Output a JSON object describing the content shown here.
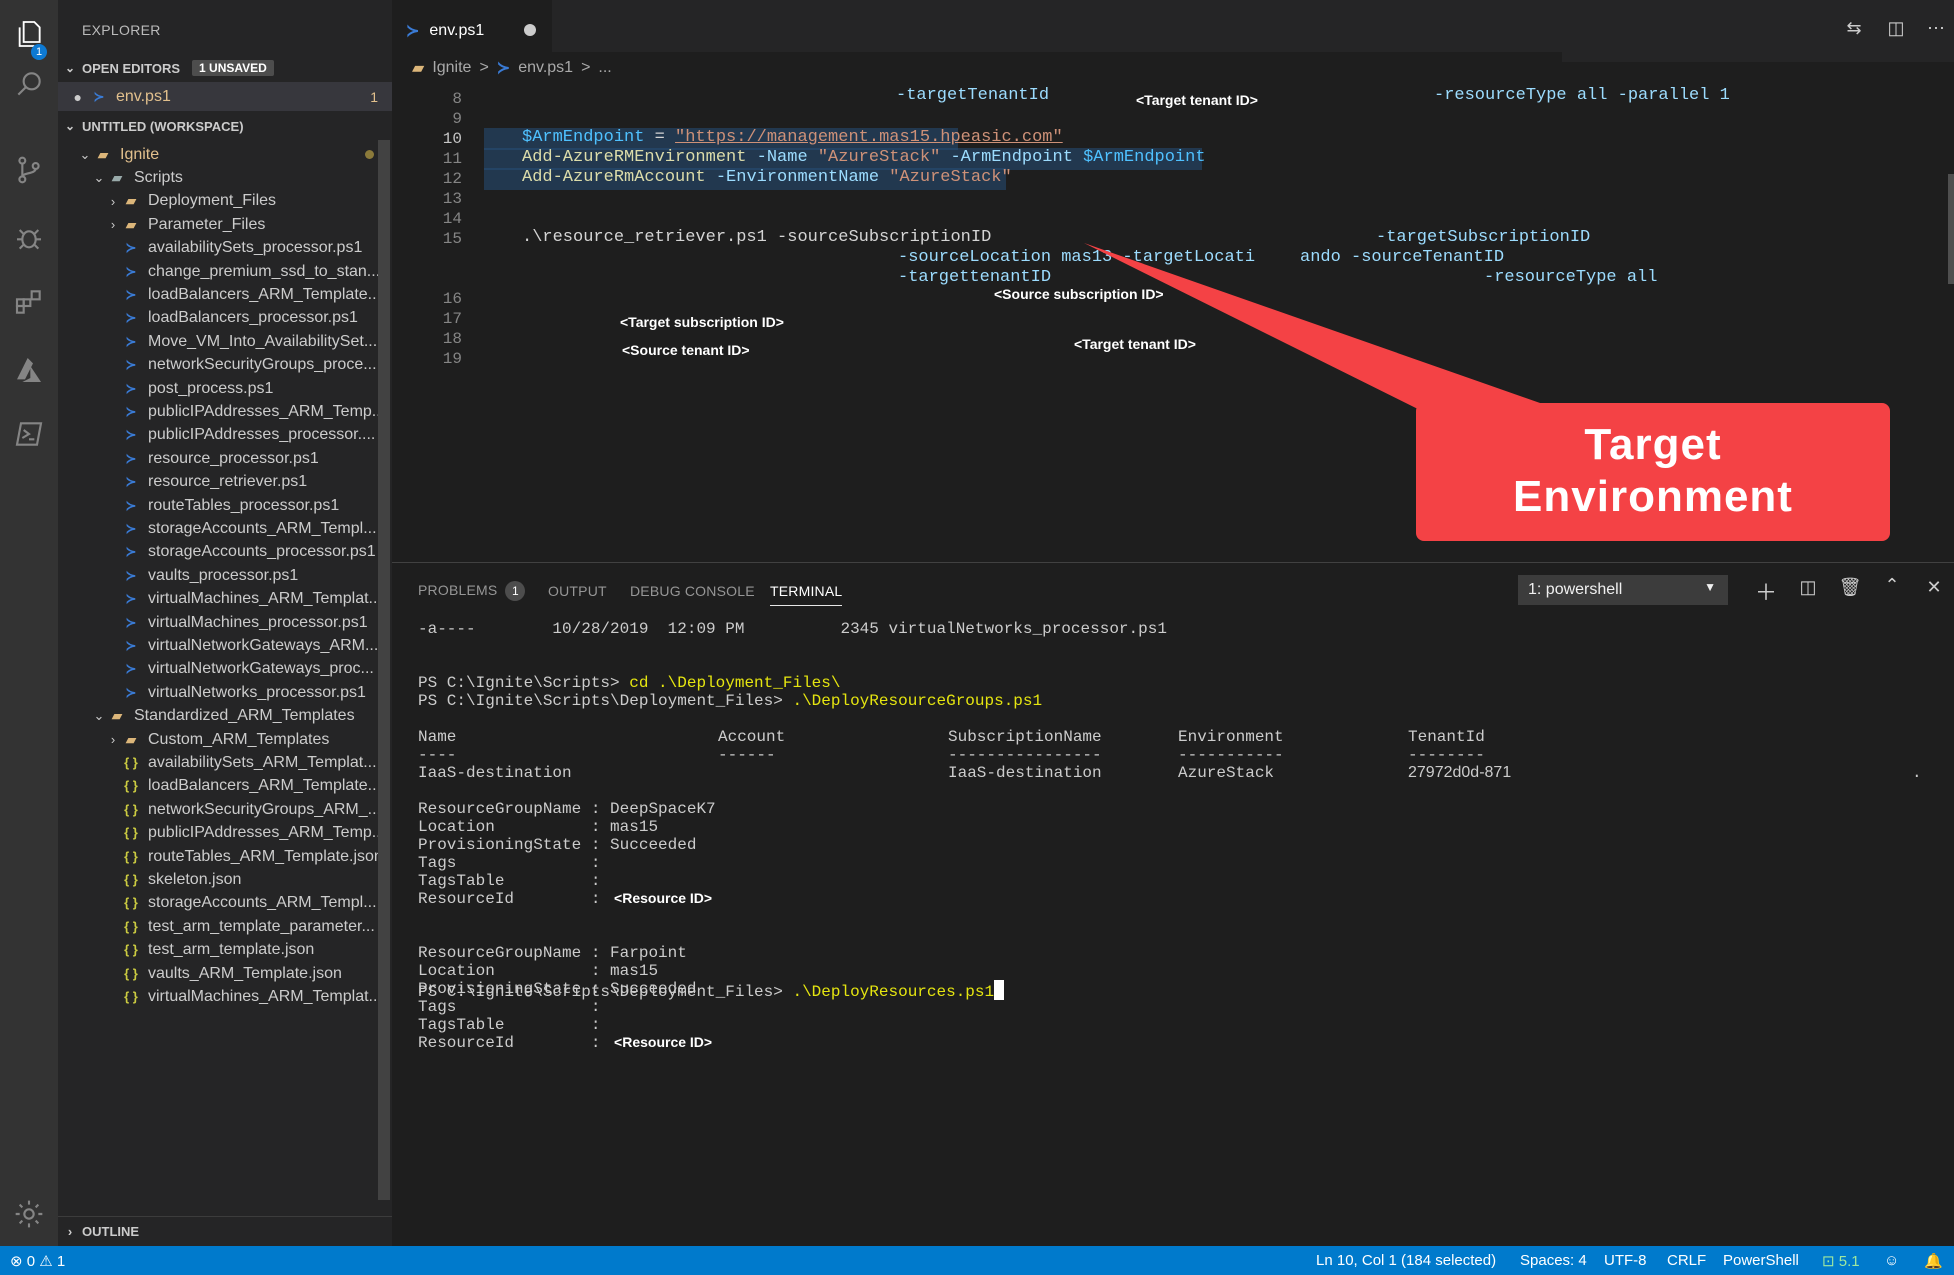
{
  "explorer": {
    "title": "EXPLORER",
    "open_editors": "OPEN EDITORS",
    "unsaved_badge": "1 UNSAVED",
    "open_file": "env.ps1",
    "open_file_count": "1",
    "workspace": "UNTITLED (WORKSPACE)",
    "outline": "OUTLINE",
    "tree": [
      {
        "label": "Ignite",
        "kind": "folder-root"
      },
      {
        "label": "Scripts",
        "kind": "folder-open"
      },
      {
        "label": "Deployment_Files",
        "kind": "folder"
      },
      {
        "label": "Parameter_Files",
        "kind": "folder"
      },
      {
        "label": "availabilitySets_processor.ps1",
        "kind": "ps"
      },
      {
        "label": "change_premium_ssd_to_stan...",
        "kind": "ps"
      },
      {
        "label": "loadBalancers_ARM_Template...",
        "kind": "ps"
      },
      {
        "label": "loadBalancers_processor.ps1",
        "kind": "ps"
      },
      {
        "label": "Move_VM_Into_AvailabilitySet...",
        "kind": "ps"
      },
      {
        "label": "networkSecurityGroups_proce...",
        "kind": "ps"
      },
      {
        "label": "post_process.ps1",
        "kind": "ps"
      },
      {
        "label": "publicIPAddresses_ARM_Temp...",
        "kind": "ps"
      },
      {
        "label": "publicIPAddresses_processor....",
        "kind": "ps"
      },
      {
        "label": "resource_processor.ps1",
        "kind": "ps"
      },
      {
        "label": "resource_retriever.ps1",
        "kind": "ps"
      },
      {
        "label": "routeTables_processor.ps1",
        "kind": "ps"
      },
      {
        "label": "storageAccounts_ARM_Templ...",
        "kind": "ps"
      },
      {
        "label": "storageAccounts_processor.ps1",
        "kind": "ps"
      },
      {
        "label": "vaults_processor.ps1",
        "kind": "ps"
      },
      {
        "label": "virtualMachines_ARM_Templat...",
        "kind": "ps"
      },
      {
        "label": "virtualMachines_processor.ps1",
        "kind": "ps"
      },
      {
        "label": "virtualNetworkGateways_ARM...",
        "kind": "ps"
      },
      {
        "label": "virtualNetworkGateways_proc...",
        "kind": "ps"
      },
      {
        "label": "virtualNetworks_processor.ps1",
        "kind": "ps"
      },
      {
        "label": "Standardized_ARM_Templates",
        "kind": "folder-open"
      },
      {
        "label": "Custom_ARM_Templates",
        "kind": "folder"
      },
      {
        "label": "availabilitySets_ARM_Templat...",
        "kind": "json"
      },
      {
        "label": "loadBalancers_ARM_Template....",
        "kind": "json"
      },
      {
        "label": "networkSecurityGroups_ARM_...",
        "kind": "json"
      },
      {
        "label": "publicIPAddresses_ARM_Temp...",
        "kind": "json"
      },
      {
        "label": "routeTables_ARM_Template.json",
        "kind": "json"
      },
      {
        "label": "skeleton.json",
        "kind": "json"
      },
      {
        "label": "storageAccounts_ARM_Templ...",
        "kind": "json"
      },
      {
        "label": "test_arm_template_parameter...",
        "kind": "json"
      },
      {
        "label": "test_arm_template.json",
        "kind": "json"
      },
      {
        "label": "vaults_ARM_Template.json",
        "kind": "json"
      },
      {
        "label": "virtualMachines_ARM_Templat...",
        "kind": "json"
      }
    ]
  },
  "editor": {
    "tab": "env.ps1",
    "breadcrumb": [
      "Ignite",
      ">",
      "env.ps1",
      ">",
      "..."
    ],
    "line_numbers": [
      "8",
      "9",
      "10",
      "11",
      "12",
      "13",
      "14",
      "15",
      "16",
      "17",
      "18",
      "19"
    ],
    "top_line": {
      "a": "-targetTenantId",
      "b": "-resourceType all -parallel 1",
      "ann": "<Target tenant ID>"
    },
    "l10": {
      "var": "$ArmEndpoint",
      "eq": " = ",
      "str": "\"https://management.mas15.hpeasic.com\""
    },
    "l11": {
      "cmd": "Add-AzureRMEnvironment",
      "p1": " -Name ",
      "s1": "\"AzureStack\"",
      "p2": " -ArmEndpoint ",
      "v": "$ArmEndpoint"
    },
    "l12": {
      "cmd": "Add-AzureRmAccount",
      "p1": " -EnvironmentName ",
      "s1": "\"AzureStack\""
    },
    "l15": {
      "a": ".\\resource_retriever.ps1 -sourceSubscriptionID",
      "b": "-targetSubscriptionID",
      "c": "-sourceLocation mas13 -targetLocati",
      "c2": "ando -sourceTenantID",
      "d": "-targettenantID",
      "e": "-resourceType all"
    },
    "annotations": {
      "source_sub": "<Source subscription ID>",
      "target_sub": "<Target subscription ID>",
      "source_tenant": "<Source tenant ID>",
      "target_tenant": "<Target tenant ID>"
    },
    "callout": [
      "Target",
      "Environment"
    ]
  },
  "panel": {
    "tabs": [
      "PROBLEMS",
      "OUTPUT",
      "DEBUG CONSOLE",
      "TERMINAL"
    ],
    "problems_count": "1",
    "terminal_select": "1: powershell",
    "terminal": {
      "line1": "-a----        10/28/2019  12:09 PM          2345 virtualNetworks_processor.ps1",
      "prompt1": "PS C:\\Ignite\\Scripts> ",
      "cmd1": "cd .\\Deployment_Files\\",
      "prompt2": "PS C:\\Ignite\\Scripts\\Deployment_Files> ",
      "cmd2": ".\\DeployResourceGroups.ps1",
      "headers": [
        "Name",
        "Account",
        "SubscriptionName",
        "Environment",
        "TenantId"
      ],
      "underlines": [
        "----",
        "------",
        "----------------",
        "-----------",
        "--------"
      ],
      "row": [
        "IaaS-destination",
        "",
        "IaaS-destination",
        "AzureStack",
        "27972d0d-871"
      ],
      "trailing_dot": ".",
      "groups": [
        {
          "name": "DeepSpaceK7",
          "location": "mas15",
          "state": "Succeeded",
          "rid": "<Resource ID>"
        },
        {
          "name": "Farpoint",
          "location": "mas15",
          "state": "Succeeded",
          "rid": "<Resource ID>"
        }
      ],
      "keys": [
        "ResourceGroupName : ",
        "Location          : ",
        "ProvisioningState : ",
        "Tags              : ",
        "TagsTable         : ",
        "ResourceId        : "
      ],
      "prompt3": "PS C:\\Ignite\\Scripts\\Deployment_Files> ",
      "cmd3": ".\\DeployResources.ps1"
    }
  },
  "status": {
    "errors": "0",
    "warnings": "1",
    "position": "Ln 10, Col 1 (184 selected)",
    "spaces": "Spaces: 4",
    "encoding": "UTF-8",
    "eol": "CRLF",
    "language": "PowerShell",
    "ps_version": "5.1"
  },
  "colors": {
    "accent": "#007acc",
    "callout": "#f44245"
  }
}
